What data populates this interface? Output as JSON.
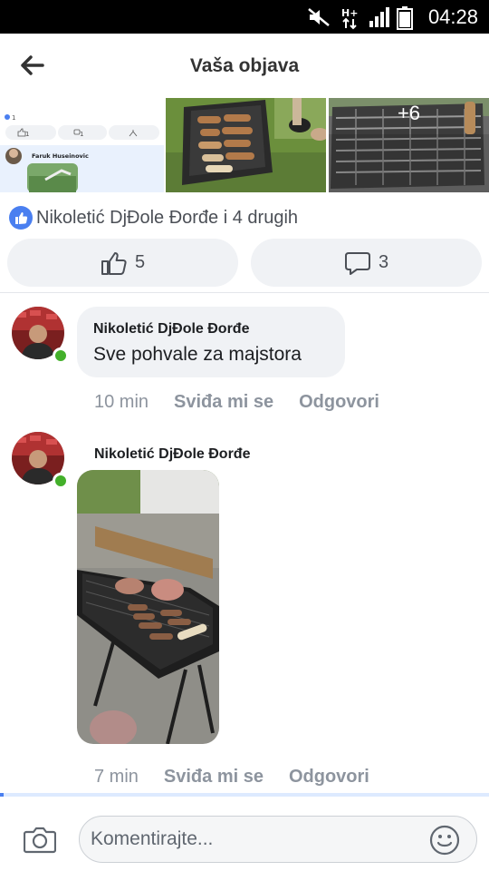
{
  "status_bar": {
    "time": "04:28",
    "icons": [
      "mute-icon",
      "network-h-plus-icon",
      "signal-icon",
      "battery-icon"
    ]
  },
  "header": {
    "back_icon": "back-arrow-icon",
    "title": "Vaša objava"
  },
  "thumbnails": {
    "more_count": "+6",
    "embedded_post": {
      "reaction_count": "1",
      "like_count": "1",
      "comment_count": "1",
      "author": "Faruk Huseinovic"
    }
  },
  "reactions": {
    "summary": "Nikoletić DjĐole Đorđe i 4 drugih",
    "like_count": "5",
    "comment_count": "3"
  },
  "comments": [
    {
      "author": "Nikoletić DjĐole Đorđe",
      "text": "Sve pohvale za majstora",
      "time": "10 min",
      "like_label": "Sviđa mi se",
      "reply_label": "Odgovori"
    },
    {
      "author": "Nikoletić DjĐole Đorđe",
      "time": "7 min",
      "like_label": "Sviđa mi se",
      "reply_label": "Odgovori"
    }
  ],
  "composer": {
    "placeholder": "Komentirajte...",
    "camera_icon": "camera-icon",
    "emoji_icon": "emoji-icon"
  },
  "colors": {
    "accent": "#4a7ff0",
    "online": "#43b02a",
    "pill_bg": "#f0f2f5"
  }
}
